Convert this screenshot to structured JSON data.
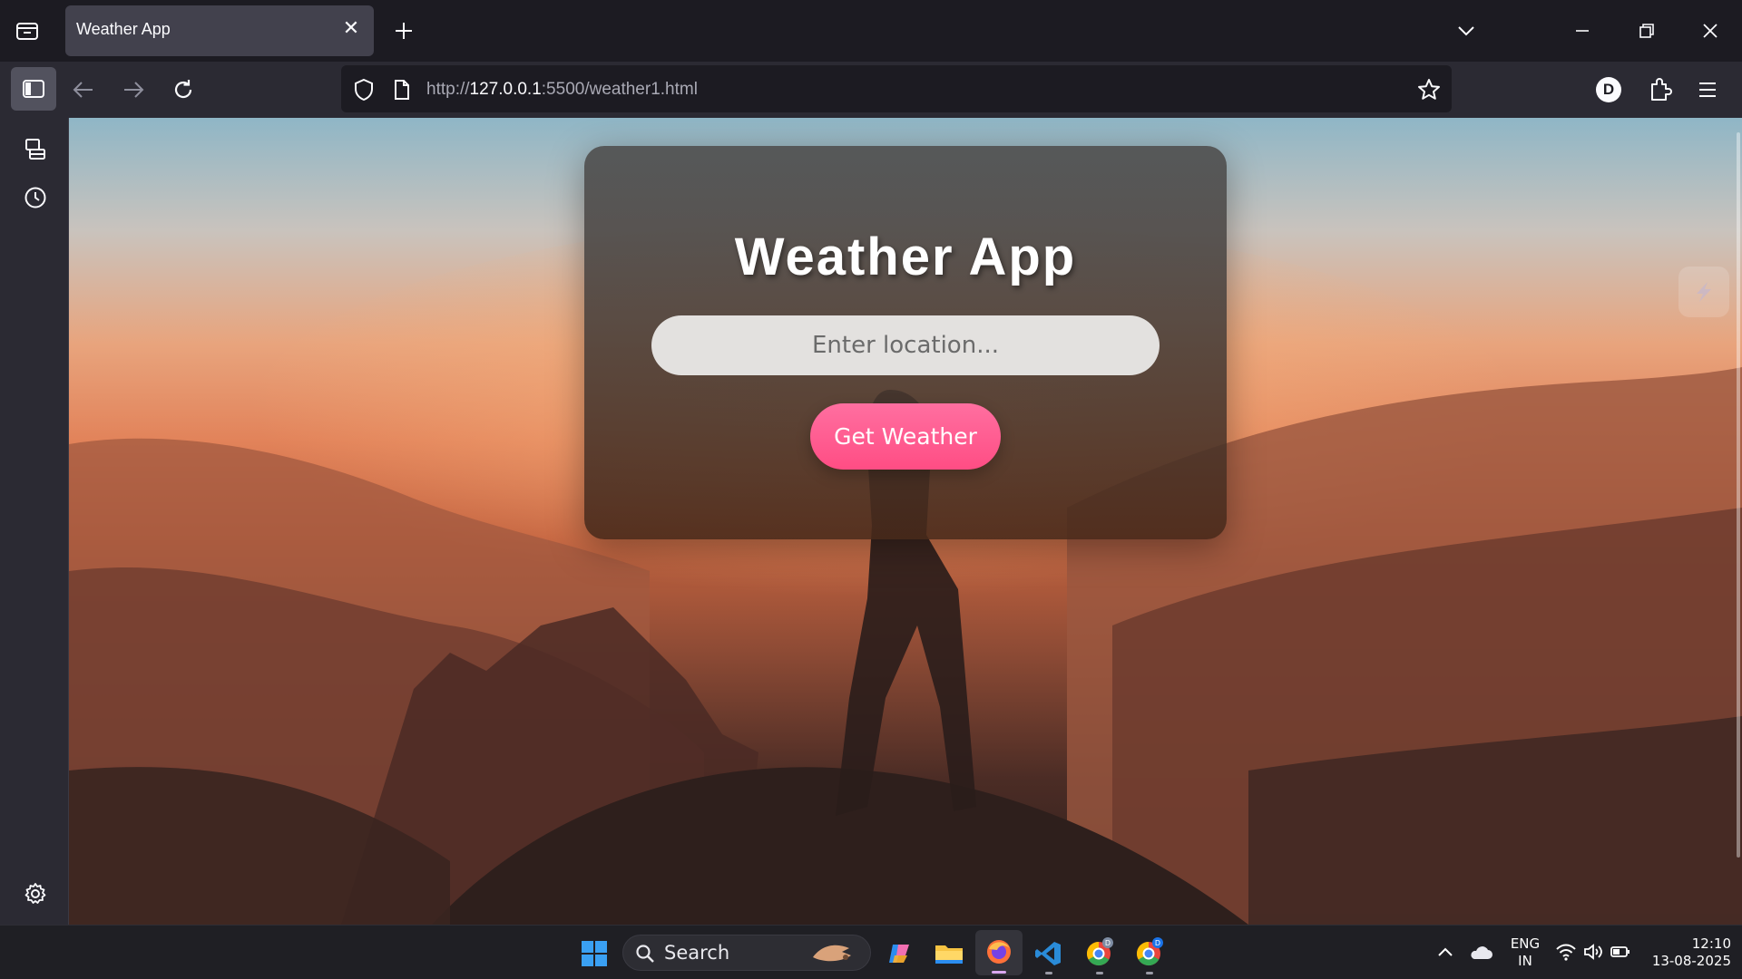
{
  "browser": {
    "tab_title": "Weather App",
    "url_prefix": "http://",
    "url_host": "127.0.0.1",
    "url_rest": ":5500/weather1.html",
    "account_initial": "D"
  },
  "app": {
    "title": "Weather App",
    "location_placeholder": "Enter location...",
    "button_label": "Get Weather",
    "button_color": "#ff5a8e"
  },
  "taskbar": {
    "search_label": "Search",
    "lang_primary": "ENG",
    "lang_secondary": "IN",
    "time": "12:10",
    "date": "13-08-2025"
  },
  "icons": {
    "tab_list": "tab-list-icon",
    "close_tab": "close-icon",
    "new_tab": "plus-icon",
    "tab_overflow": "chevron-down-icon",
    "minimize": "minimize-icon",
    "restore": "restore-icon",
    "close_window": "close-window-icon",
    "sidebar_toggle": "sidebar-icon",
    "back": "back-arrow-icon",
    "forward": "forward-arrow-icon",
    "reload": "reload-icon",
    "shield": "shield-icon",
    "page": "page-icon",
    "bookmark": "star-icon",
    "extensions": "puzzle-icon",
    "menu": "hamburger-icon",
    "sync_tabs": "synced-tabs-icon",
    "history": "clock-icon",
    "settings": "gear-icon"
  }
}
